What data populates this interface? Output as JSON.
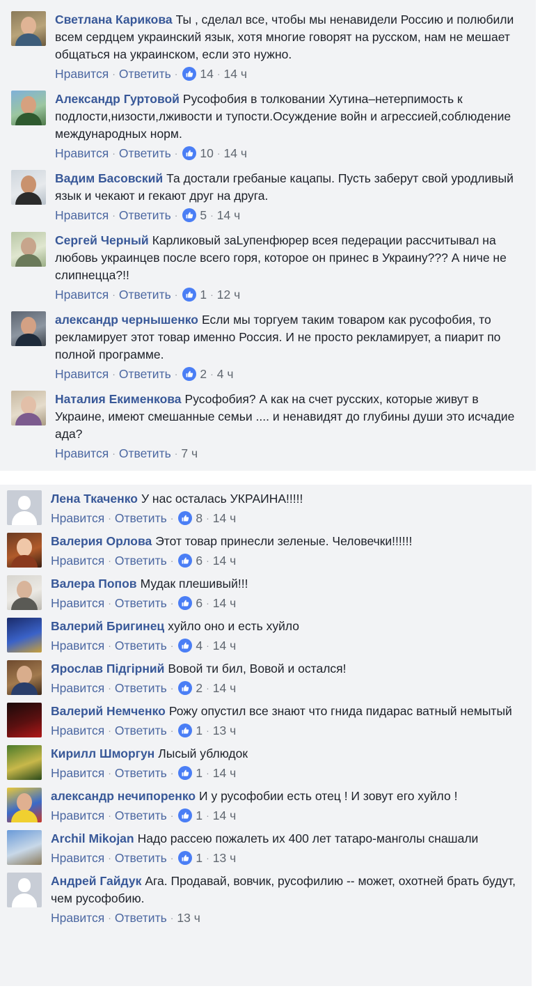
{
  "actions": {
    "like": "Нравится",
    "reply": "Ответить",
    "separator": "·"
  },
  "colors": {
    "author": "#385898",
    "like_badge": "#4a7ef5",
    "panel_bg": "#f2f3f5"
  },
  "panel1": [
    {
      "author": "Светлана Карикова",
      "text": "Ты , сделал все, чтобы мы ненавидели Россию и полюбили всем сердцем украинский язык, хотя многие говорят на русском, нам не мешает общаться на украинском, если это нужно.",
      "likes": "14",
      "time": "14 ч",
      "avatar": "photo-couple"
    },
    {
      "author": "Александр Гуртовой",
      "text": "Русофобия в толковании Хутина–нетерпимость к подлости,низости,лживости и тупости.Осуждение войн и агрессией,соблюдение международных норм.",
      "likes": "10",
      "time": "14 ч",
      "avatar": "photo-outdoor"
    },
    {
      "author": "Вадим Басовский",
      "text": "Та достали гребаные кацапы. Пусть заберут свой уродливый язык и чекают и гекают друг на друга.",
      "likes": "5",
      "time": "14 ч",
      "avatar": "photo-man"
    },
    {
      "author": "Сергей Черный",
      "text": "Карликовый заLупенфюрер всея педерации рассчитывал на любовь украинцев после всего горя, которое он принес в Украину??? А ниче не слипнецца?!!",
      "likes": "1",
      "time": "12 ч",
      "avatar": "photo-banknote"
    },
    {
      "author": "александр чернышенко",
      "text": "Если мы торгуем таким товаром как русофобия, то рекламирует этот товар именно Россия. И не просто рекламирует, а пиарит по полной программе.",
      "likes": "2",
      "time": "4 ч",
      "avatar": "photo-suit"
    },
    {
      "author": "Наталия Екименкова",
      "text": "Русофобия? А как на счет русских, которые живут в Украине, имеют смешанные семьи .... и ненавидят до глубины души это исчадие ада?",
      "likes": "",
      "time": "7 ч",
      "avatar": "photo-woman"
    }
  ],
  "panel2": [
    {
      "author": "Лена Ткаченко",
      "text": "У нас осталась УКРАИНА!!!!!",
      "likes": "8",
      "time": "14 ч",
      "avatar": "default"
    },
    {
      "author": "Валерия Орлова",
      "text": "Этот товар принесли зеленые. Человечки!!!!!!",
      "likes": "6",
      "time": "14 ч",
      "avatar": "photo-redhair"
    },
    {
      "author": "Валера Попов",
      "text": "Мудак плешивый!!!",
      "likes": "6",
      "time": "14 ч",
      "avatar": "photo-bald"
    },
    {
      "author": "Валерий Бригинец",
      "text": "хуйло оно и есть хуйло",
      "likes": "4",
      "time": "14 ч",
      "avatar": "photo-lights"
    },
    {
      "author": "Ярослав Підгірний",
      "text": "Вовой ти бил, Вовой и остался!",
      "likes": "2",
      "time": "14 ч",
      "avatar": "photo-room"
    },
    {
      "author": "Валерий Немченко",
      "text": "Рожу опустил все знают что гнида пидарас ватный немытый",
      "likes": "1",
      "time": "13 ч",
      "avatar": "photo-emblem"
    },
    {
      "author": "Кирилл Шморгун",
      "text": "Лысый ублюдок",
      "likes": "1",
      "time": "14 ч",
      "avatar": "photo-trident"
    },
    {
      "author": "александр нечипоренко",
      "text": "И у русофобии есть отец ! И зовут его хуйло !",
      "likes": "1",
      "time": "14 ч",
      "avatar": "photo-fans"
    },
    {
      "author": "Archil Mikojan",
      "text": "Надо рассею пожалеть их 400 лет татаро-манголы снашали",
      "likes": "1",
      "time": "13 ч",
      "avatar": "photo-castle"
    },
    {
      "author": "Андрей Гайдук",
      "text": "Ага. Продавай, вовчик, русофилию -- может, охотней брать будут, чем русофобию.",
      "likes": "",
      "time": "13 ч",
      "avatar": "default"
    }
  ]
}
